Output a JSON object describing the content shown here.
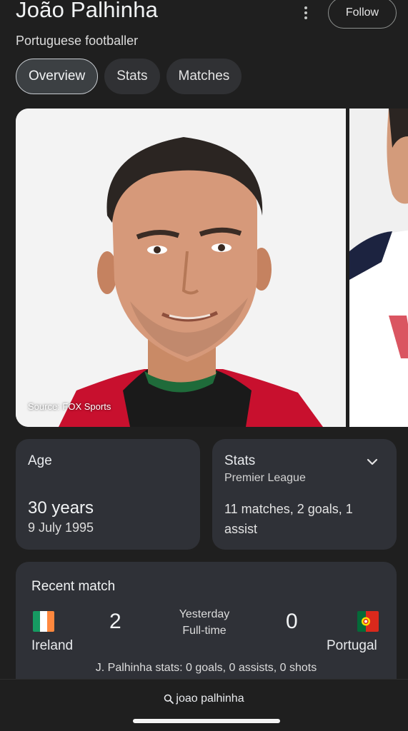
{
  "header": {
    "title": "João Palhinha",
    "subtitle": "Portuguese footballer",
    "follow_label": "Follow"
  },
  "tabs": [
    {
      "label": "Overview",
      "active": true
    },
    {
      "label": "Stats",
      "active": false
    },
    {
      "label": "Matches",
      "active": false
    }
  ],
  "gallery": {
    "source": "Source: FOX Sports"
  },
  "age_card": {
    "label": "Age",
    "value": "30 years",
    "date": "9 July 1995"
  },
  "stats_card": {
    "label": "Stats",
    "league": "Premier League",
    "text": "11 matches, 2 goals, 1 assist",
    "icon": "chevron-down-icon"
  },
  "recent_match": {
    "title": "Recent match",
    "home_team": "Ireland",
    "away_team": "Portugal",
    "home_score": "2",
    "away_score": "0",
    "when": "Yesterday",
    "status": "Full-time",
    "player_stats": "J. Palhinha stats: 0 goals, 0 assists, 0 shots"
  },
  "bottom_bar": {
    "query": "joao palhinha",
    "icon": "search-icon"
  },
  "colors": {
    "background": "#1f1f1f",
    "card": "#2f3137",
    "ireland_green": "#169b62",
    "ireland_orange": "#ff883e",
    "portugal_green": "#046a38",
    "portugal_red": "#da291c"
  }
}
